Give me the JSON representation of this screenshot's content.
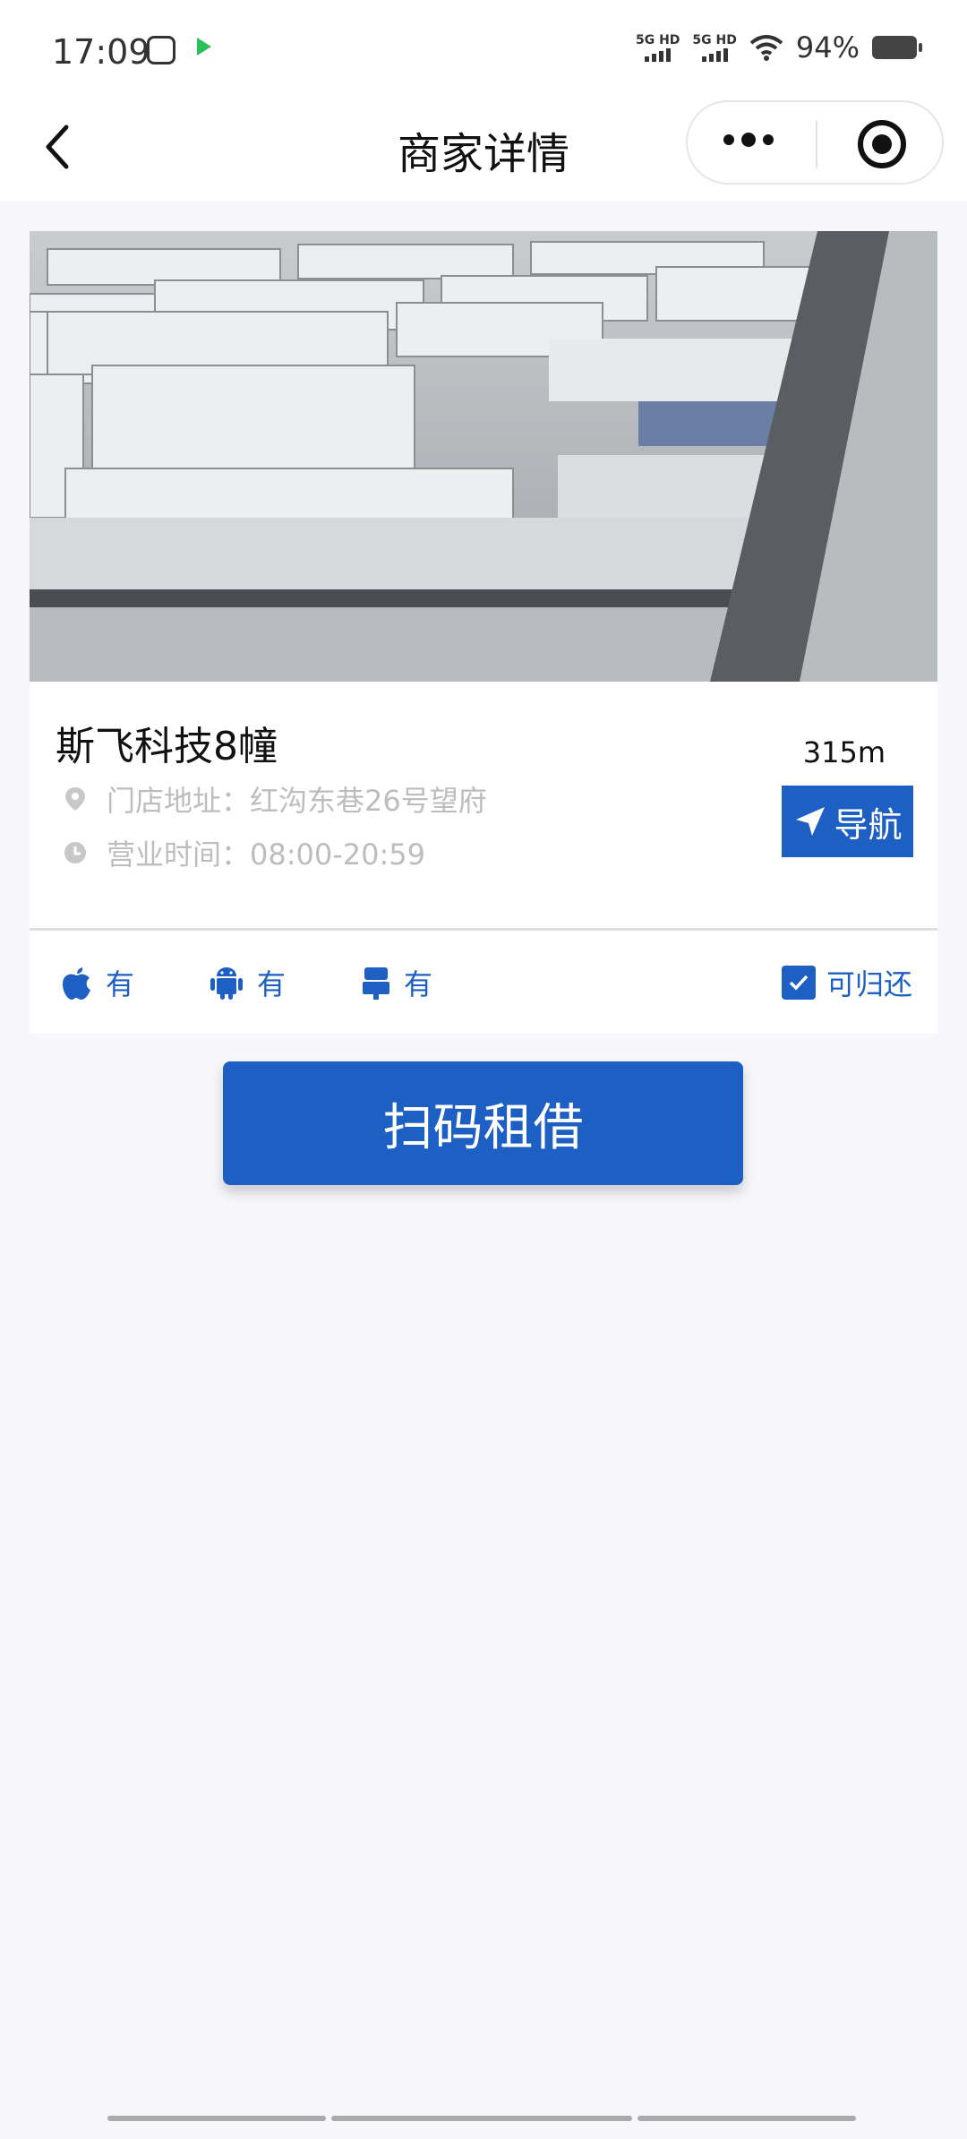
{
  "status_bar": {
    "time": "17:09",
    "network1": "5G HD",
    "network2": "5G HD",
    "battery": "94%"
  },
  "header": {
    "title": "商家详情"
  },
  "shop": {
    "name": "斯飞科技8幢",
    "address_label": "门店地址：红沟东巷26号望府",
    "hours_label": "营业时间：08:00-20:59",
    "distance": "315m",
    "nav_label": "导航"
  },
  "features": {
    "ios": "有",
    "android": "有",
    "typec": "有",
    "returnable": "可归还",
    "returnable_checked": true
  },
  "action": {
    "scan_label": "扫码租借"
  },
  "colors": {
    "primary": "#1d5fc3",
    "muted": "#bdbdbd",
    "background": "#f7f7fb"
  }
}
